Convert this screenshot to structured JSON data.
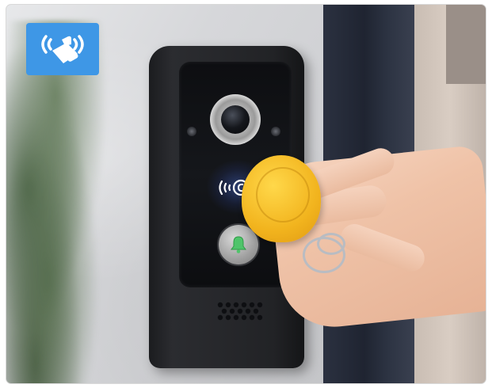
{
  "scene": {
    "badge_icon": "nfc-tap-icon",
    "doorbell_icons": {
      "nfc": "nfc-card-icon",
      "bell": "bell-icon"
    },
    "colors": {
      "badge": "#3e97e6",
      "fob": "#f2b41e",
      "doorbell": "#1b1c1f"
    }
  }
}
